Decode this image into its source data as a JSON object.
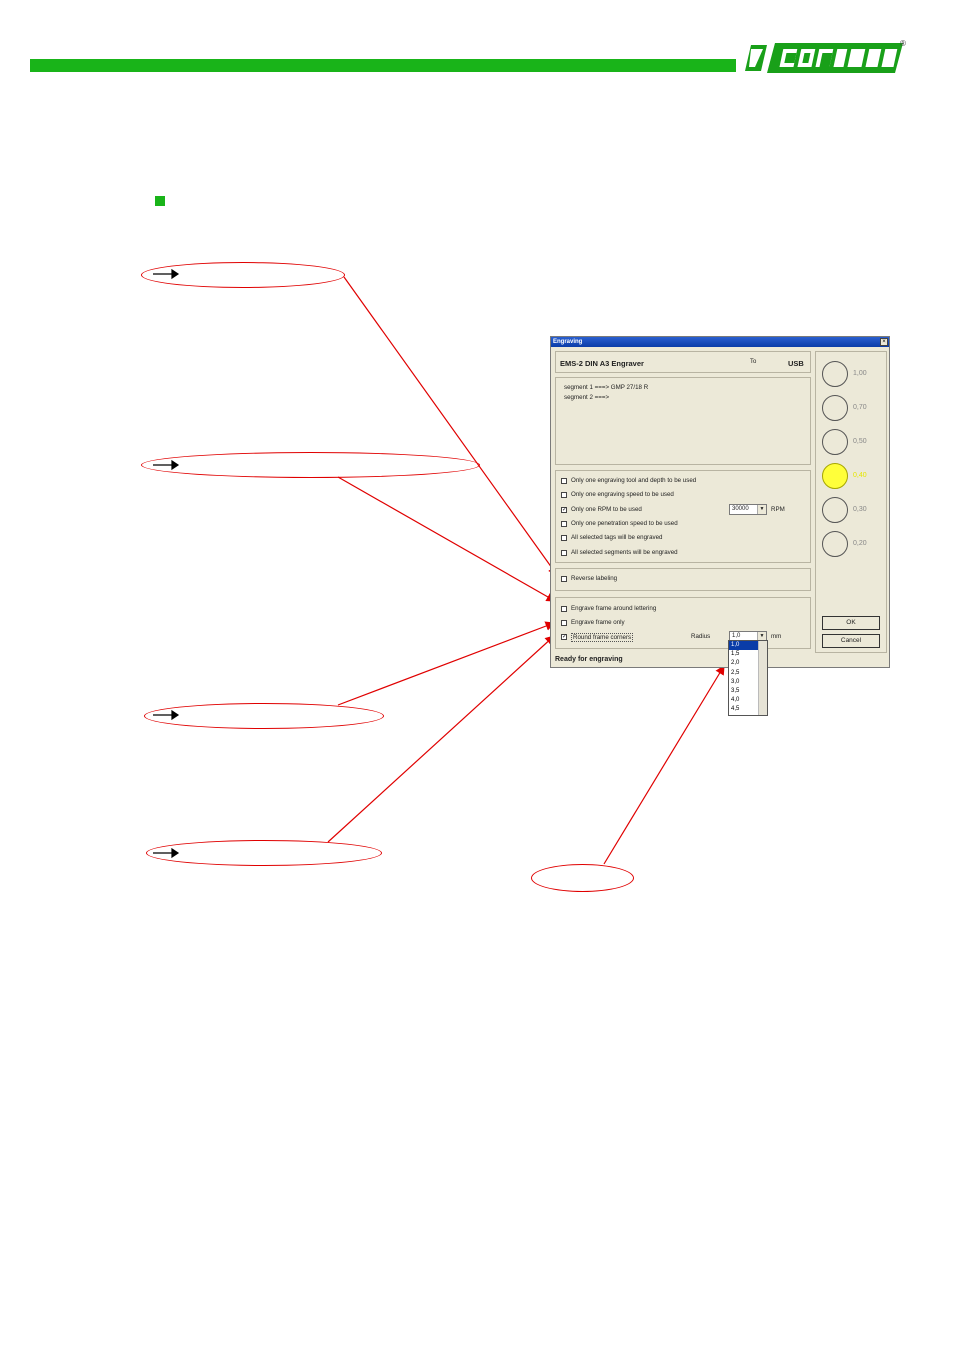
{
  "dialog": {
    "title": "Engraving",
    "close_glyph": "×",
    "device": "EMS-2 DIN A3 Engraver",
    "to_label": "To",
    "port": "USB",
    "segments": [
      "segment 1  ===>  GMP 27/18 R",
      "segment 2  ===>"
    ],
    "options": [
      {
        "label": "Only one engraving tool and depth to be used",
        "checked": false
      },
      {
        "label": "Only one engraving speed to be used",
        "checked": false
      },
      {
        "label": "Only one RPM to be used",
        "checked": true
      },
      {
        "label": "Only one penetration speed to be used",
        "checked": false
      },
      {
        "label": "All selected tags will be engraved",
        "checked": false
      },
      {
        "label": "All selected segments will be engraved",
        "checked": false
      }
    ],
    "rpm": {
      "value": "30000",
      "unit": "RPM"
    },
    "reverse_labeling": {
      "label": "Reverse labeling",
      "checked": false
    },
    "frame_options": [
      {
        "label": "Engrave frame around lettering",
        "checked": false
      },
      {
        "label": "Engrave frame only",
        "checked": false
      },
      {
        "label": "Round frame corners",
        "checked": true
      }
    ],
    "radius": {
      "label": "Radius",
      "value": "1,0",
      "unit": "mm"
    },
    "radius_options": [
      "1,0",
      "1,5",
      "2,0",
      "2,5",
      "3,0",
      "3,5",
      "4,0",
      "4,5"
    ],
    "status": "Ready for engraving",
    "tools": [
      "1,00",
      "0,70",
      "0,50",
      "0,40",
      "0,30",
      "0,20"
    ],
    "selected_tool": "0,40",
    "ok_label": "OK",
    "cancel_label": "Cancel"
  },
  "colors": {
    "brand_green": "#19b419",
    "annotation_red": "#e00000",
    "selected_tool": "#ffff3a"
  },
  "logo_alt": "CONTA-CLIP",
  "registered_mark": "®"
}
